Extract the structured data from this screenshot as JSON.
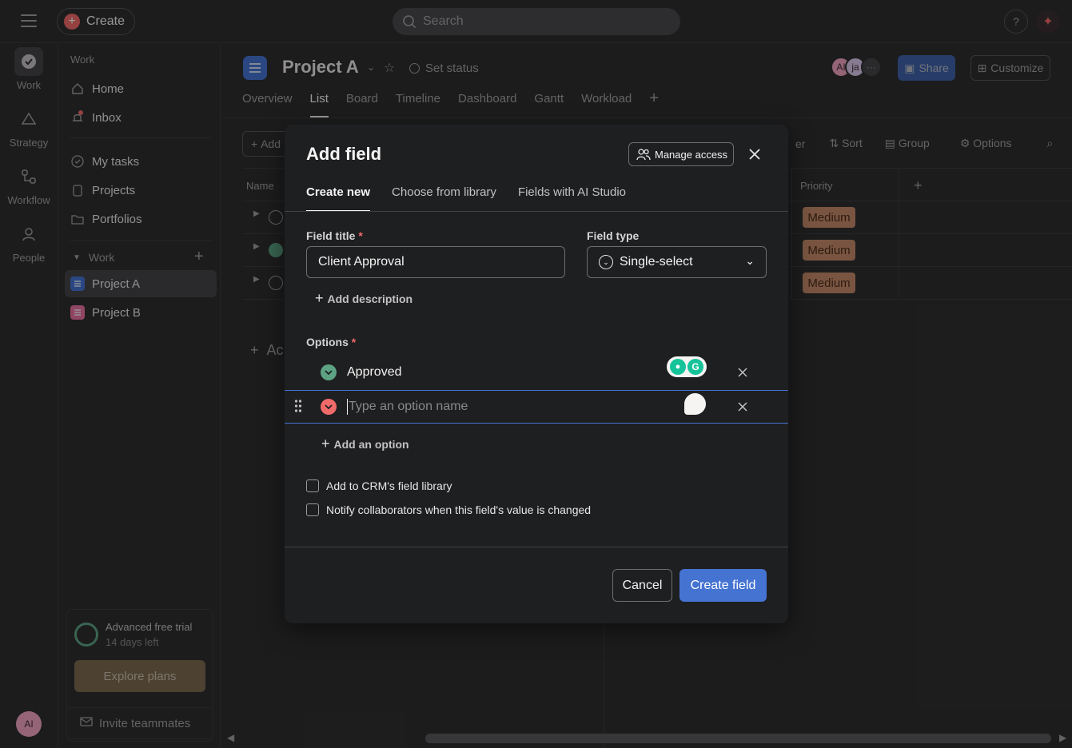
{
  "topbar": {
    "create_label": "Create",
    "search_placeholder": "Search",
    "help_label": "?"
  },
  "rail": {
    "items": [
      {
        "label": "Work",
        "icon": "check-circle-icon"
      },
      {
        "label": "Strategy",
        "icon": "triangle-icon"
      },
      {
        "label": "Workflow",
        "icon": "workflow-icon"
      },
      {
        "label": "People",
        "icon": "people-icon"
      }
    ],
    "avatar_initials": "AI"
  },
  "sidebar": {
    "section_work": "Work",
    "items": [
      {
        "label": "Home",
        "icon": "home-icon"
      },
      {
        "label": "Inbox",
        "icon": "bell-icon"
      },
      {
        "label": "My tasks",
        "icon": "check-circle-icon"
      },
      {
        "label": "Projects",
        "icon": "clipboard-icon"
      },
      {
        "label": "Portfolios",
        "icon": "folder-icon"
      }
    ],
    "projects_header": "Work",
    "projects": [
      {
        "label": "Project A",
        "color": "#4573d2"
      },
      {
        "label": "Project B",
        "color": "#e8719e"
      }
    ],
    "trial_title": "Advanced free trial",
    "trial_days": "14 days left",
    "explore_label": "Explore plans",
    "invite_label": "Invite teammates"
  },
  "main": {
    "project_title": "Project A",
    "set_status": "Set status",
    "tabs": [
      "Overview",
      "List",
      "Board",
      "Timeline",
      "Dashboard",
      "Gantt",
      "Workload"
    ],
    "active_tab": "List",
    "avatars": [
      "AI",
      "ja"
    ],
    "share_label": "Share",
    "customize_label": "Customize",
    "add_task_partial": "Add",
    "add_section_partial": "Ac",
    "toolbar": {
      "filter_partial": "er",
      "sort": "Sort",
      "group": "Group",
      "options": "Options"
    },
    "columns": {
      "name": "Name",
      "priority": "Priority"
    },
    "priority_values": [
      "Medium",
      "Medium",
      "Medium"
    ]
  },
  "modal": {
    "title": "Add field",
    "manage_access": "Manage access",
    "tabs": [
      "Create new",
      "Choose from library",
      "Fields with AI Studio"
    ],
    "field_title_label": "Field title",
    "field_title_value": "Client Approval",
    "field_type_label": "Field type",
    "field_type_value": "Single-select",
    "add_description": "Add description",
    "options_label": "Options",
    "options": [
      {
        "value": "Approved",
        "color": "#5da283"
      },
      {
        "value": "",
        "placeholder": "Type an option name",
        "color": "#f06a6a"
      }
    ],
    "add_option": "Add an option",
    "checkbox_library": "Add to CRM's field library",
    "checkbox_notify": "Notify collaborators when this field's value is changed",
    "cancel_label": "Cancel",
    "create_label": "Create field"
  }
}
